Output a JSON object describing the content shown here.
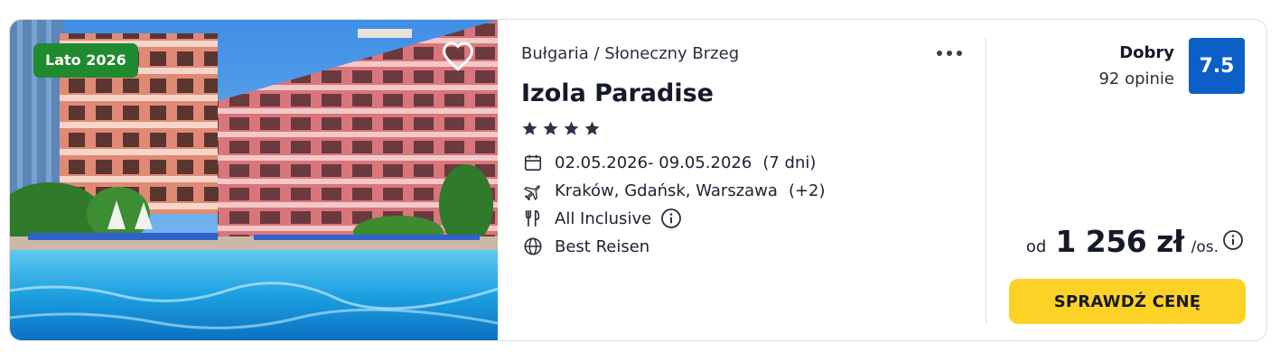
{
  "offer": {
    "badge": "Lato 2026",
    "breadcrumb": "Bułgaria / Słoneczny Brzeg",
    "hotel_name": "Izola Paradise",
    "stars": 4,
    "dates": "02.05.2026- 09.05.2026",
    "duration": "(7 dni)",
    "departures": "Kraków, Gdańsk, Warszawa",
    "departures_more": "(+2)",
    "board": "All Inclusive",
    "operator": "Best Reisen",
    "icons": {
      "favorite": "heart-icon",
      "more": "more-dots-icon",
      "calendar": "calendar-icon",
      "flight": "plane-icon",
      "board": "cutlery-icon",
      "operator": "globe-icon",
      "info": "info-icon"
    }
  },
  "rating": {
    "label": "Dobry",
    "reviews": "92 opinie",
    "score": "7.5"
  },
  "price": {
    "prefix": "od",
    "amount": "1 256 zł",
    "suffix": "/os."
  },
  "cta": {
    "label": "SPRAWDŹ CENĘ"
  },
  "colors": {
    "badge": "#1f8a2e",
    "score": "#0c5fc6",
    "cta": "#fcd226"
  }
}
